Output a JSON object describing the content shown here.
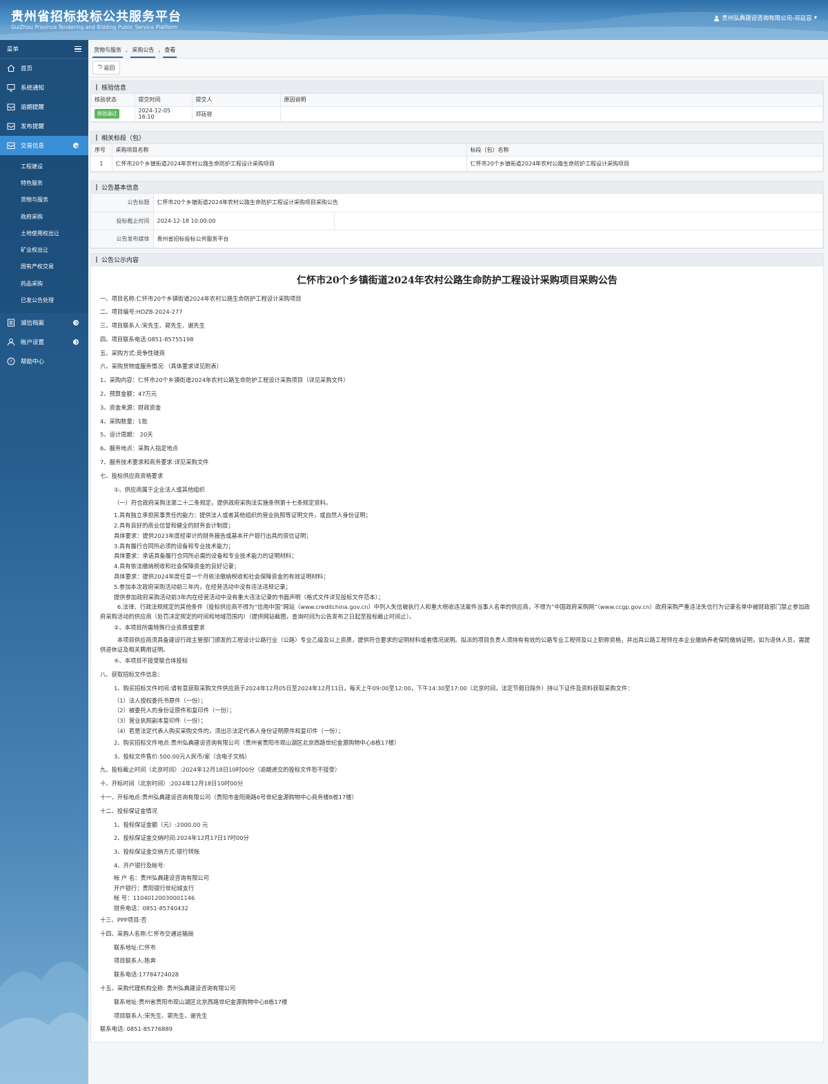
{
  "header": {
    "title": "贵州省招标投标公共服务平台",
    "subtitle": "GuiZhou Province Tendering and Bidding Public Service Platform",
    "user": "贵州弘典建设咨询有限公司-邓廷容"
  },
  "sidebar": {
    "menu_label": "菜单",
    "items": [
      {
        "label": "首页",
        "icon": "home-icon"
      },
      {
        "label": "系统通知",
        "icon": "monitor-icon"
      },
      {
        "label": "逾期提醒",
        "icon": "inbox-icon"
      },
      {
        "label": "发布提醒",
        "icon": "inbox-icon"
      },
      {
        "label": "交易信息",
        "icon": "inbox-icon"
      }
    ],
    "sub_items": [
      "工程建设",
      "特色服务",
      "货物与服务",
      "政府采购",
      "土地使用权出让",
      "矿业权出让",
      "国有产权交易",
      "药品采购",
      "已发公告处理"
    ],
    "bottom_items": [
      {
        "label": "诚信档案",
        "icon": "list-icon"
      },
      {
        "label": "帐户设置",
        "icon": "user-icon"
      },
      {
        "label": "帮助中心",
        "icon": "help-icon"
      }
    ]
  },
  "breadcrumb": [
    "货物与服务",
    "采购公告",
    "查看"
  ],
  "toolbar": {
    "back_label": "返回"
  },
  "review": {
    "title": "核验信息",
    "headers": [
      "核验状态",
      "提交时间",
      "提交人",
      "原因说明"
    ],
    "status": "核验通过",
    "time": "2024-12-05 16:10",
    "submitter": "邓廷容",
    "reason": ""
  },
  "sections": {
    "title": "相关标段（包）",
    "headers": [
      "序号",
      "采购项目名称",
      "标段（包）名称"
    ],
    "row": {
      "no": "1",
      "project": "仁怀市20个乡镇街道2024年农村公路生命防护工程设计采购项目",
      "section": "仁怀市20个乡镇街道2024年农村公路生命防护工程设计采购项目"
    }
  },
  "basic": {
    "title": "公告基本信息",
    "title_label": "公告标题",
    "title_value": "仁怀市20个乡镇街道2024年农村公路生命防护工程设计采购项目采购公告",
    "deadline_label": "投标截止时间",
    "deadline_value": "2024-12-18 10:00:00",
    "media_label": "公告发布媒体",
    "media_value": "贵州省招标投标公共服务平台"
  },
  "content": {
    "title": "公告公示内容",
    "doc_title": "仁怀市20个乡镇街道2024年农村公路生命防护工程设计采购项目采购公告",
    "lines": [
      {
        "c": "",
        "t": "一、项目名称:仁怀市20个乡镇街道2024年农村公路生命防护工程设计采购项目"
      },
      {
        "c": "",
        "t": "二、项目编号:HDZB-2024-277"
      },
      {
        "c": "",
        "t": "三、项目联系人:宋先生、郭先生、谢先生"
      },
      {
        "c": "",
        "t": "四、项目联系电话:0851-85755198"
      },
      {
        "c": "",
        "t": "五、采购方式:竞争性磋商"
      },
      {
        "c": "",
        "t": "六、采购货物或服务情况:（具体要求详见附表）"
      },
      {
        "c": "",
        "t": "1、采购内容：仁怀市20个乡镇街道2024年农村公路生命防护工程设计采购项目（详见采购文件）"
      },
      {
        "c": "",
        "t": "2、预算金额：47万元"
      },
      {
        "c": "",
        "t": "3、资金来源：财政资金"
      },
      {
        "c": "",
        "t": "4、采购数量：1批"
      },
      {
        "c": "",
        "t": "5、设计周期：  20天"
      },
      {
        "c": "",
        "t": "6、服务地点：采购人指定地点"
      },
      {
        "c": "",
        "t": "7、服务技术要求和商务要求:详见采购文件"
      },
      {
        "c": "",
        "t": "七、投标供应商资格要求"
      },
      {
        "c": "i1",
        "t": "①、供应商属于企业法人或其他组织"
      },
      {
        "c": "i1",
        "t": "（一）符合政府采购法第二十二条规定，提供政府采购法实施条例第十七条规定资料。"
      },
      {
        "c": "i1 t",
        "t": "1.具有独立承担民事责任的能力：提供法人或者其他组织的营业执照等证明文件，或自然人身份证明；"
      },
      {
        "c": "i1 t",
        "t": "2.具有良好的商业信誉和健全的财务会计制度；"
      },
      {
        "c": "i1 t",
        "t": "具体要求：提供2023年度经审计的财务报告或基本开户银行出具的资信证明；"
      },
      {
        "c": "i1 t",
        "t": "3.具有履行合同所必须的设备和专业技术能力；"
      },
      {
        "c": "i1 t",
        "t": "具体要求：承诺具备履行合同所必需的设备和专业技术能力的证明材料；"
      },
      {
        "c": "i1 t",
        "t": "4.具有依法缴纳税收和社会保障资金的良好记录；"
      },
      {
        "c": "i1 t",
        "t": "具体要求：提供2024年度任意一个月依法缴纳税收和社会保障资金的有效证明材料；"
      },
      {
        "c": "i1 t",
        "t": "5.参加本次政府采购活动前三年内，在经营活动中没有违法违规记录；"
      },
      {
        "c": "i1 t",
        "t": "提供参加政府采购活动前3年内在经营活动中没有重大违法记录的书面声明（格式文件详见投标文件范本）；"
      },
      {
        "c": "w",
        "t": "　　　6.法律、行政法规规定的其他条件（投标供应商不得为“信用中国”网站（www.creditchina.gov.cn）中列入失信被执行人和重大税收违法案件当事人名单的供应商，不得为“中国政府采购网”（www.ccgp.gov.cn）政府采购严重违法失信行为记录名单中被财政部门禁止参加政府采购活动的供应商（处罚决定规定的时间和地域范围内）（提供网站截图，查询时间为公告发布之日起至投标截止时间止）。"
      },
      {
        "c": "i1",
        "t": "②、本项目所需特殊行业资质或要求"
      },
      {
        "c": "w",
        "t": "　　　本项目供应商须具备建设行政主管部门颁发的工程设计公路行业（公路）专业乙级及以上资质，提供符合要求的证明材料或者情况说明。拟派的项目负责人须持有有效的公路专业工程师及以上职称资格，并出具公路工程师在本企业缴纳养老保险缴纳证明，如为退休人员，需提供退休证及相关聘用证明。"
      },
      {
        "c": "i1",
        "t": "④、本项目不接受联合体投标"
      },
      {
        "c": "",
        "t": "八、获取招标文件信息："
      },
      {
        "c": "i1",
        "t": "1、购买招标文件时间:请有意获取采购文件供应商于2024年12月05日至2024年12月11日，每天上午09:00至12:00，下午14:30至17:00（北京时间，法定节假日除外）持以下证件及资料获取采购文件："
      },
      {
        "c": "i1 t",
        "t": "（1）法人授权委托书原件（一份）；"
      },
      {
        "c": "i1 t",
        "t": "（2）被委托人的身份证原件和复印件（一份）；"
      },
      {
        "c": "i1 t",
        "t": "（3）营业执照副本复印件（一份）；"
      },
      {
        "c": "i1 t",
        "t": "（4）若是法定代表人购买采购文件的，须出示法定代表人身份证明原件和复印件（一份）；"
      },
      {
        "c": "i1",
        "t": "2、购买招标文件地点:贵州弘典建设咨询有限公司（贵州省贵阳市观山湖区北京西路世纪金源购物中心B栋17楼）"
      },
      {
        "c": "i1",
        "t": "3、投标文件售价:500.00元人民币/家（含电子文档）"
      },
      {
        "c": "",
        "t": "九、投标截止时间（北京时间）:2024年12月18日10时00分（逾期递交的投标文件恕不接受）"
      },
      {
        "c": "",
        "t": "十、开标时间（北京时间）:2024年12月18日10时00分"
      },
      {
        "c": "",
        "t": "十一、开标地点:贵州弘典建设咨询有限公司（贵阳市金阳南路6号世纪金源购物中心商务楼B栋17楼）"
      },
      {
        "c": "",
        "t": "十二、投标保证金情况"
      },
      {
        "c": "i1",
        "t": "1、投标保证金额（元）:2000.00 元"
      },
      {
        "c": "i1",
        "t": "2、投标保证金交纳时间:2024年12月17日17时00分"
      },
      {
        "c": "i1",
        "t": "3、投标保证金交纳方式:银行转账"
      },
      {
        "c": "i1",
        "t": "4、开户银行及帐号:"
      },
      {
        "c": "i1 t",
        "t": "帐 户 名：贵州弘典建设咨询有限公司"
      },
      {
        "c": "i1 t",
        "t": "开户银行：贵阳银行世纪城支行"
      },
      {
        "c": "i1 t",
        "t": "帐      号：11040120030001146"
      },
      {
        "c": "i1 t",
        "t": "财务电话：0851-85740432"
      },
      {
        "c": "",
        "t": "十三、PPP项目:否"
      },
      {
        "c": "",
        "t": "十四、采购人名称:仁怀市交通运输局"
      },
      {
        "c": "i1",
        "t": "联系地址:仁怀市"
      },
      {
        "c": "i1",
        "t": "项目联系人:陈奔"
      },
      {
        "c": "i1",
        "t": "联系电话:17784724028"
      },
      {
        "c": "",
        "t": "十五、采购代理机构全称: 贵州弘典建设咨询有限公司"
      },
      {
        "c": "i1",
        "t": "联系地址:贵州省贵阳市观山湖区北京西路世纪金源购物中心B栋17楼"
      },
      {
        "c": "i1",
        "t": "项目联系人:宋先生、郭先生、谢先生"
      },
      {
        "c": "",
        "t": "联系电话: 0851-85776889"
      }
    ]
  },
  "colors": {
    "sidebar": "#255d8f",
    "active": "#3b8fd6",
    "badge": "#5cb85c"
  }
}
